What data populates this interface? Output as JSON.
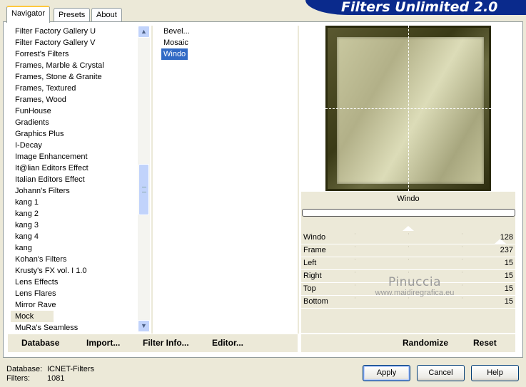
{
  "tabs": [
    "Navigator",
    "Presets",
    "About"
  ],
  "app_title": "Filters Unlimited 2.0",
  "categories": [
    "Filter Factory Gallery U",
    "Filter Factory Gallery V",
    "Forrest's Filters",
    "Frames, Marble & Crystal",
    "Frames, Stone & Granite",
    "Frames, Textured",
    "Frames, Wood",
    "FunHouse",
    "Gradients",
    "Graphics Plus",
    "I-Decay",
    "Image Enhancement",
    "It@lian Editors Effect",
    "Italian Editors Effect",
    "Johann's Filters",
    "kang 1",
    "kang 2",
    "kang 3",
    "kang 4",
    "kang",
    "Kohan's Filters",
    "Krusty's FX vol. I 1.0",
    "Lens Effects",
    "Lens Flares",
    "Mirror Rave",
    "Mock",
    "MuRa's Seamless"
  ],
  "selected_category": "Mock",
  "filters": [
    "Bevel...",
    "Mosaic",
    "Windo"
  ],
  "selected_filter": "Windo",
  "filter_name": "Windo",
  "params": [
    {
      "label": "Windo",
      "value": "128",
      "level": 0.5
    },
    {
      "label": "Frame",
      "value": "237",
      "level": 0.93
    },
    {
      "label": "Left",
      "value": "15"
    },
    {
      "label": "Right",
      "value": "15"
    },
    {
      "label": "Top",
      "value": "15"
    },
    {
      "label": "Bottom",
      "value": "15"
    }
  ],
  "watermark": {
    "name": "Pinuccia",
    "url": "www.maidiregrafica.eu"
  },
  "buttons": {
    "database": "Database",
    "import": "Import...",
    "filter_info": "Filter Info...",
    "editor": "Editor...",
    "randomize": "Randomize",
    "reset": "Reset",
    "apply": "Apply",
    "cancel": "Cancel",
    "help": "Help"
  },
  "status": {
    "database_label": "Database:",
    "database_value": "ICNET-Filters",
    "filters_label": "Filters:",
    "filters_value": "1081"
  },
  "colors": {
    "accent": "#0a2a8c",
    "selection": "#316ac5",
    "frame_dark": "#2a2a0c",
    "preview_light": "#c9c8a0"
  }
}
